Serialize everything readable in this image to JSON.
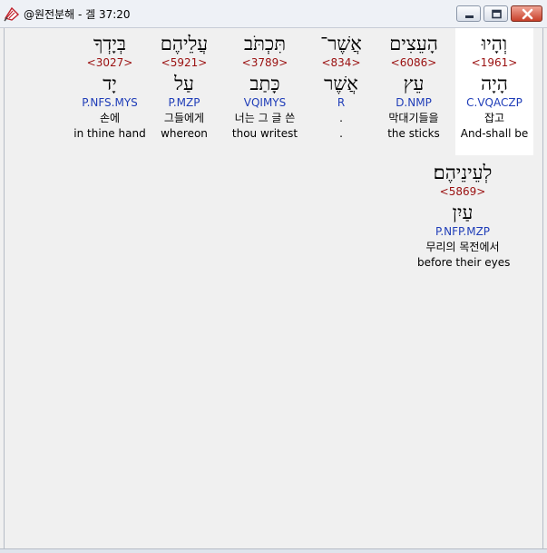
{
  "window": {
    "title": "@원전분해 - 겔 37:20",
    "icon": "pencil-book-icon",
    "buttons": {
      "minimize": "minimize-icon",
      "maximize": "maximize-icon",
      "close": "close-icon"
    }
  },
  "colors": {
    "strong_number": "#9a1010",
    "parsing": "#1f3db8",
    "highlight_bg": "#ffffff",
    "background": "#f0f0f0"
  },
  "words": [
    {
      "hebrew": "וְהָיוּ",
      "strong": "<1961>",
      "lemma": "הָיָה",
      "parsing": "C.VQACZP",
      "korean": "잡고",
      "english": "And-shall be",
      "selected": true
    },
    {
      "hebrew": "הָעֵצִים",
      "strong": "<6086>",
      "lemma": "עֵץ",
      "parsing": "D.NMP",
      "korean": "막대기들을",
      "english": "the sticks",
      "selected": false
    },
    {
      "hebrew": "אֲשֶׁר־",
      "strong": "<834>",
      "lemma": "אֲשֶׁר",
      "parsing": "R",
      "korean": ".",
      "english": ".",
      "selected": false
    },
    {
      "hebrew": "תִּכְתֹּב",
      "strong": "<3789>",
      "lemma": "כָּתַב",
      "parsing": "VQIMYS",
      "korean": "너는 그 글 쓴",
      "english": "thou writest",
      "selected": false
    },
    {
      "hebrew": "עֲלֵיהֶם",
      "strong": "<5921>",
      "lemma": "עַל",
      "parsing": "P.MZP",
      "korean": "그들에게",
      "english": "whereon",
      "selected": false
    },
    {
      "hebrew": "בְּיָדְךָ",
      "strong": "<3027>",
      "lemma": "יָד",
      "parsing": "P.NFS.MYS",
      "korean": "손에",
      "english": "in thine hand",
      "selected": false
    },
    {
      "hebrew": "לְעֵינֵיהֶם׃",
      "strong": "<5869>",
      "lemma": "עַיִן",
      "parsing": "P.NFP.MZP",
      "korean": "무리의 목전에서",
      "english": "before their eyes",
      "selected": false
    }
  ]
}
